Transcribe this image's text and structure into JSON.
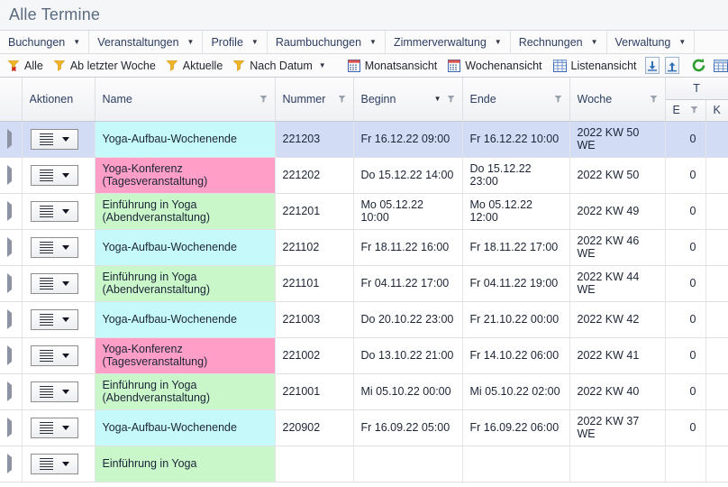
{
  "page_title": "Alle Termine",
  "menu": [
    {
      "label": "Buchungen",
      "icon": "chevron-down-icon"
    },
    {
      "label": "Veranstaltungen",
      "icon": "chevron-down-icon"
    },
    {
      "label": "Profile",
      "icon": "chevron-down-icon"
    },
    {
      "label": "Raumbuchungen",
      "icon": "chevron-down-icon"
    },
    {
      "label": "Zimmerverwaltung",
      "icon": "chevron-down-icon"
    },
    {
      "label": "Rechnungen",
      "icon": "chevron-down-icon"
    },
    {
      "label": "Verwaltung",
      "icon": "chevron-down-icon"
    }
  ],
  "toolbar": {
    "items": [
      {
        "label": "Alle",
        "icon": "filter-clear-icon"
      },
      {
        "label": "Ab letzter Woche",
        "icon": "filter-icon"
      },
      {
        "label": "Aktuelle",
        "icon": "filter-icon"
      },
      {
        "label": "Nach Datum",
        "icon": "filter-icon",
        "caret": true
      },
      {
        "label": "Monatsansicht",
        "icon": "calendar-icon"
      },
      {
        "label": "Wochenansicht",
        "icon": "calendar-icon"
      },
      {
        "label": "Listenansicht",
        "icon": "table-icon"
      }
    ],
    "buttons": [
      {
        "name": "collapse-all-button",
        "icon": "arrow-down-box-icon"
      },
      {
        "name": "expand-all-button",
        "icon": "arrow-up-box-icon"
      },
      {
        "name": "refresh-button",
        "icon": "refresh-icon"
      },
      {
        "name": "export-button",
        "icon": "grid-export-icon"
      }
    ]
  },
  "grid": {
    "columns": [
      {
        "key": "expand",
        "label": "",
        "filter": false
      },
      {
        "key": "actions",
        "label": "Aktionen",
        "filter": false
      },
      {
        "key": "name",
        "label": "Name",
        "filter": true
      },
      {
        "key": "nummer",
        "label": "Nummer",
        "filter": true
      },
      {
        "key": "beginn",
        "label": "Beginn",
        "filter": true,
        "sorted": true
      },
      {
        "key": "ende",
        "label": "Ende",
        "filter": true
      },
      {
        "key": "woche",
        "label": "Woche",
        "filter": true
      }
    ],
    "group_header": "T",
    "sub_columns": [
      {
        "key": "e",
        "label": "E",
        "filter": true
      },
      {
        "key": "k",
        "label": "K",
        "filter": true
      }
    ],
    "row_action_label": "menu-button",
    "rows": [
      {
        "selected": true,
        "name": "Yoga-Aufbau-Wochenende",
        "name2": "",
        "color": "#c6fafa",
        "nummer": "221203",
        "beginn": "Fr 16.12.22 09:00",
        "ende": "Fr 16.12.22 10:00",
        "woche": "2022 KW 50 WE",
        "e": "0",
        "k": ""
      },
      {
        "selected": false,
        "name": "Yoga-Konferenz",
        "name2": "(Tagesveranstaltung)",
        "color": "#ff9ec6",
        "nummer": "221202",
        "beginn": "Do 15.12.22 14:00",
        "ende": "Do 15.12.22 23:00",
        "woche": "2022 KW 50",
        "e": "0",
        "k": ""
      },
      {
        "selected": false,
        "name": "Einführung in Yoga",
        "name2": "(Abendveranstaltung)",
        "color": "#caf7ca",
        "nummer": "221201",
        "beginn": "Mo 05.12.22 10:00",
        "ende": "Mo 05.12.22 12:00",
        "woche": "2022 KW 49",
        "e": "0",
        "k": ""
      },
      {
        "selected": false,
        "name": "Yoga-Aufbau-Wochenende",
        "name2": "",
        "color": "#c6fafa",
        "nummer": "221102",
        "beginn": "Fr 18.11.22 16:00",
        "ende": "Fr 18.11.22 17:00",
        "woche": "2022 KW 46 WE",
        "e": "0",
        "k": ""
      },
      {
        "selected": false,
        "name": "Einführung in Yoga",
        "name2": "(Abendveranstaltung)",
        "color": "#caf7ca",
        "nummer": "221101",
        "beginn": "Fr 04.11.22 17:00",
        "ende": "Fr 04.11.22 19:00",
        "woche": "2022 KW 44 WE",
        "e": "0",
        "k": ""
      },
      {
        "selected": false,
        "name": "Yoga-Aufbau-Wochenende",
        "name2": "",
        "color": "#c6fafa",
        "nummer": "221003",
        "beginn": "Do 20.10.22 23:00",
        "ende": "Fr 21.10.22 00:00",
        "woche": "2022 KW 42",
        "e": "0",
        "k": ""
      },
      {
        "selected": false,
        "name": "Yoga-Konferenz",
        "name2": "(Tagesveranstaltung)",
        "color": "#ff9ec6",
        "nummer": "221002",
        "beginn": "Do 13.10.22 21:00",
        "ende": "Fr 14.10.22 06:00",
        "woche": "2022 KW 41",
        "e": "0",
        "k": ""
      },
      {
        "selected": false,
        "name": "Einführung in Yoga",
        "name2": "(Abendveranstaltung)",
        "color": "#caf7ca",
        "nummer": "221001",
        "beginn": "Mi 05.10.22 00:00",
        "ende": "Mi 05.10.22 02:00",
        "woche": "2022 KW 40",
        "e": "0",
        "k": ""
      },
      {
        "selected": false,
        "name": "Yoga-Aufbau-Wochenende",
        "name2": "",
        "color": "#c6fafa",
        "nummer": "220902",
        "beginn": "Fr 16.09.22 05:00",
        "ende": "Fr 16.09.22 06:00",
        "woche": "2022 KW 37 WE",
        "e": "0",
        "k": ""
      },
      {
        "selected": false,
        "name": "Einführung in Yoga",
        "name2": "",
        "color": "#caf7ca",
        "nummer": "",
        "beginn": "",
        "ende": "",
        "woche": "",
        "e": "",
        "k": ""
      }
    ]
  },
  "colors": {
    "selection": "#d3dcf5",
    "header_text": "#2c3e63",
    "title_text": "#5a6b80",
    "event_cyan": "#c6fafa",
    "event_pink": "#ff9ec6",
    "event_green": "#caf7ca"
  }
}
